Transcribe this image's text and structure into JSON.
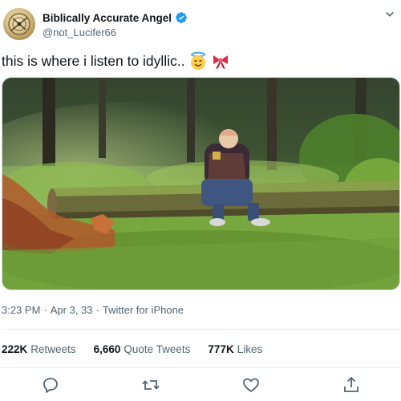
{
  "author": {
    "display_name": "Biblically Accurate Angel",
    "handle": "@not_Lucifer66",
    "verified": true,
    "verified_color": "#1d9bf0"
  },
  "tweet": {
    "text": "this is where i listen to idyllic..",
    "emojis": [
      "smiling-face-with-halo-icon",
      "ribbon-icon"
    ]
  },
  "meta": {
    "time": "3:23 PM",
    "sep1": "·",
    "date": "Apr 3, 33",
    "sep2": "·",
    "source": "Twitter for iPhone"
  },
  "stats": {
    "retweets": {
      "value": "222K",
      "label": "Retweets"
    },
    "quotes": {
      "value": "6,660",
      "label": "Quote Tweets"
    },
    "likes": {
      "value": "777K",
      "label": "Likes"
    }
  },
  "actions": [
    "reply-icon",
    "retweet-icon",
    "like-icon",
    "share-icon"
  ],
  "colors": {
    "text": "#0f1419",
    "secondary": "#536471",
    "divider": "#e6ecf0",
    "brand": "#1d9bf0"
  }
}
